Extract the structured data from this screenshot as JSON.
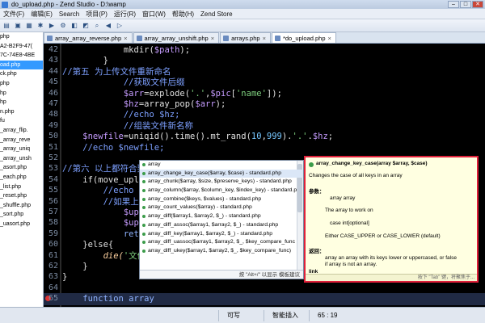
{
  "window": {
    "title": "do_upload.php - Zend Studio - D:\\wamp"
  },
  "menu": [
    "文件(F)",
    "编辑(E)",
    "Search",
    "项目(P)",
    "运行(R)",
    "窗口(W)",
    "帮助(H)",
    "Zend Store"
  ],
  "left_panel": {
    "items": [
      "php",
      "A2-B2F9-47(",
      "7C-74E8-4BE",
      "oad.php",
      "ck.php",
      "php",
      "hp",
      "hp",
      "n.php",
      "fu",
      "_array_flip.",
      "_array_reve",
      "_array_uniq",
      "_array_unsh",
      "_asort.php",
      "_each.php",
      "_list.php",
      "_reset.php",
      "_shuffle.php",
      "_sort.php",
      "_uasort.php"
    ],
    "selected_index": 3
  },
  "tabs": [
    {
      "label": "array_array_reverse.php",
      "active": false
    },
    {
      "label": "array_array_unshift.php",
      "active": false
    },
    {
      "label": "arrays.php",
      "active": false
    },
    {
      "label": "*do_upload.php",
      "active": true
    }
  ],
  "editor": {
    "lines": [
      {
        "num": "42",
        "segs": [
          [
            "c-fn",
            "            mkdir("
          ],
          [
            "c-var",
            "$path"
          ],
          [
            "c-fn",
            ");"
          ]
        ]
      },
      {
        "num": "43",
        "segs": [
          [
            "c-plain",
            "        }"
          ]
        ]
      },
      {
        "num": "44",
        "segs": [
          [
            "c-cm",
            "//第五 为上传文件重新命名"
          ]
        ]
      },
      {
        "num": "45",
        "segs": [
          [
            "c-cm",
            "            //获取文件后缀"
          ]
        ]
      },
      {
        "num": "46",
        "segs": [
          [
            "c-var",
            "            $arr"
          ],
          [
            "c-plain",
            "=explode("
          ],
          [
            "c-str",
            "'.'"
          ],
          [
            "c-plain",
            ","
          ],
          [
            "c-var",
            "$pic"
          ],
          [
            "c-plain",
            "["
          ],
          [
            "c-str",
            "'name'"
          ],
          [
            "c-plain",
            "]);"
          ]
        ]
      },
      {
        "num": "47",
        "segs": [
          [
            "c-var",
            "            $hz"
          ],
          [
            "c-plain",
            "=array_pop("
          ],
          [
            "c-var",
            "$arr"
          ],
          [
            "c-plain",
            ");"
          ]
        ]
      },
      {
        "num": "48",
        "segs": [
          [
            "c-cm",
            "            //echo $hz;"
          ]
        ]
      },
      {
        "num": "49",
        "segs": [
          [
            "c-cm",
            "            //组装文件新名称"
          ]
        ]
      },
      {
        "num": "50",
        "segs": [
          [
            "c-var",
            "    $newfile"
          ],
          [
            "c-plain",
            "=uniqid().time().mt_rand("
          ],
          [
            "c-num",
            "10"
          ],
          [
            "c-plain",
            ","
          ],
          [
            "c-num",
            "999"
          ],
          [
            "c-plain",
            ")."
          ],
          [
            "c-str",
            "'.'"
          ],
          [
            "c-plain",
            "."
          ],
          [
            "c-var",
            "$hz"
          ],
          [
            "c-plain",
            ";"
          ]
        ]
      },
      {
        "num": "51",
        "segs": [
          [
            "c-cm",
            "    //echo $newfile;"
          ]
        ]
      },
      {
        "num": "52",
        "segs": [
          [
            "c-plain",
            ""
          ]
        ]
      },
      {
        "num": "53",
        "segs": [
          [
            "c-cm",
            "//第六 以上都符合要求"
          ]
        ]
      },
      {
        "num": "54",
        "segs": [
          [
            "c-plain",
            "    if(move_uploa"
          ]
        ]
      },
      {
        "num": "55",
        "segs": [
          [
            "c-cm",
            "        //echo '文件"
          ]
        ]
      },
      {
        "num": "56",
        "segs": [
          [
            "c-cm",
            "        //如果上传成"
          ]
        ]
      },
      {
        "num": "57",
        "segs": [
          [
            "c-var",
            "            $upload"
          ]
        ]
      },
      {
        "num": "58",
        "segs": [
          [
            "c-var",
            "            $upload"
          ]
        ]
      },
      {
        "num": "59",
        "segs": [
          [
            "c-kw",
            "            return "
          ],
          [
            "c-var",
            "$"
          ]
        ]
      },
      {
        "num": "60",
        "segs": [
          [
            "c-plain",
            "    }else{"
          ]
        ]
      },
      {
        "num": "61",
        "segs": [
          [
            "c-ital",
            "        die("
          ],
          [
            "c-str",
            "'文件上传"
          ]
        ]
      },
      {
        "num": "62",
        "segs": [
          [
            "c-plain",
            "    }"
          ]
        ]
      },
      {
        "num": "63",
        "segs": [
          [
            "c-plain",
            "}"
          ]
        ]
      },
      {
        "num": "64",
        "segs": [
          [
            "c-plain",
            ""
          ]
        ]
      },
      {
        "num": "65",
        "segs": [
          [
            "c-kw",
            "    function array"
          ]
        ],
        "current": true,
        "error": true
      }
    ]
  },
  "autocomplete": {
    "items": [
      "array",
      "array_change_key_case($array, $case) - standard.php",
      "array_chunk($array, $size, $preserve_keys) - standard.php",
      "array_column($array, $column_key, $index_key) - standard.p",
      "array_combine($keys, $values) - standard.php",
      "array_count_values($array) - standard.php",
      "array_diff($array1, $array2, $_) - standard.php",
      "array_diff_assoc($array1, $array2, $_) - standard.php",
      "array_diff_key($array1, $array2, $_) - standard.php",
      "array_diff_uassoc($array1, $array2, $_, $key_compare_func",
      "array_diff_ukey($array1, $array2, $_, $key_compare_func)"
    ],
    "selected_index": 1,
    "footer": "按 \"Alt+/\" 以显示 模板建议"
  },
  "doc_popup": {
    "signature": "array_change_key_case(array $array, $case)",
    "description": "Changes the case of all keys in an array",
    "params_label": "参数：",
    "param1": "array array",
    "param1_desc": "The array to work on",
    "param2": "case int[optional]",
    "param2_desc": "Either CASE_UPPER or CASE_LOWER (default)",
    "return_label": "返回：",
    "return_desc1": "array an array with its keys lower or uppercased, or false",
    "return_desc2": "if array is not an array.",
    "link_label": "link",
    "footer": "按下 \"Tab\" 键，将聚焦于..."
  },
  "status": {
    "writable": "可写",
    "insert_mode": "智能插入",
    "position": "65 : 19"
  }
}
